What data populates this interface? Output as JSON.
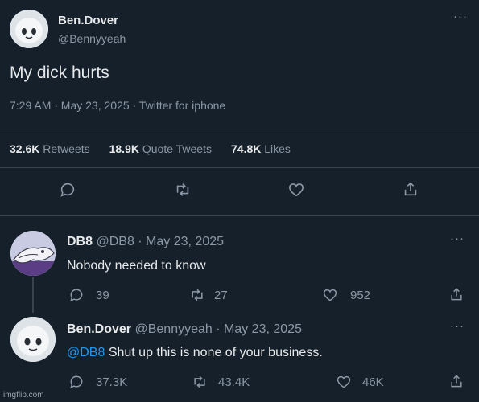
{
  "main_tweet": {
    "display_name": "Ben.Dover",
    "handle": "@Bennyyeah",
    "text": "My dick hurts",
    "meta": "7:29 AM · May 23, 2025 · Twitter for iphone",
    "more": "···",
    "stats": [
      {
        "value": "32.6K",
        "label": "Retweets"
      },
      {
        "value": "18.9K",
        "label": "Quote Tweets"
      },
      {
        "value": "74.8K",
        "label": "Likes"
      }
    ],
    "actions": [
      "reply-icon",
      "retweet-icon",
      "like-icon",
      "share-icon"
    ]
  },
  "replies": [
    {
      "display_name": "DB8",
      "handle_date": "@DB8 · May 23, 2025",
      "text": "Nobody needed to know",
      "more": "···",
      "reply_count": "39",
      "retweet_count": "27",
      "like_count": "952"
    },
    {
      "display_name": "Ben.Dover",
      "handle_date": "@Bennyyeah · May 23, 2025",
      "mention": "@DB8",
      "text": " Shut up this is none of your business.",
      "more": "···",
      "reply_count": "37.3K",
      "retweet_count": "43.4K",
      "like_count": "46K"
    }
  ],
  "watermark": "imgflip.com",
  "colors": {
    "background": "#15202b",
    "text": "#e7e9ea",
    "muted": "#8b98a5",
    "mention": "#1d9bf0",
    "divider": "#38444d"
  }
}
